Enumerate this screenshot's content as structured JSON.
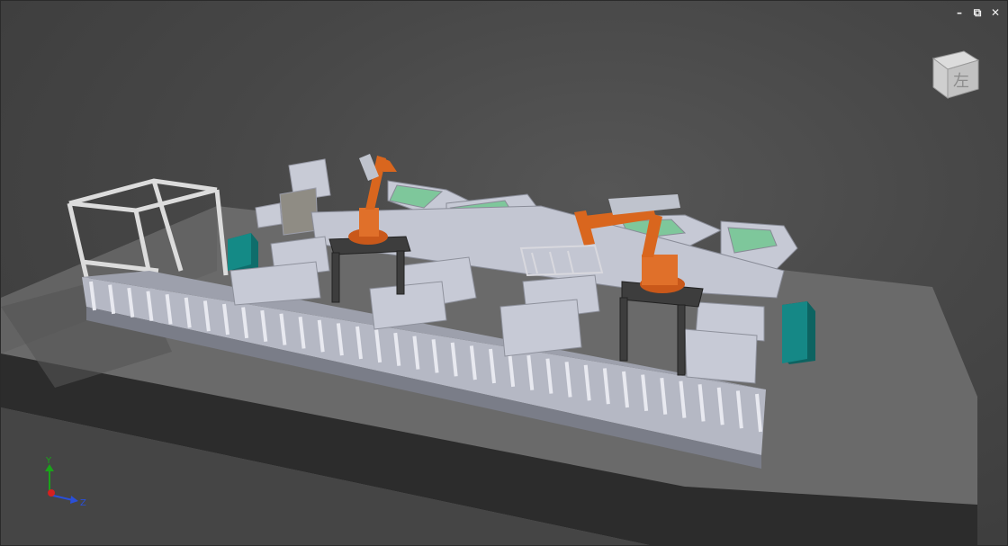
{
  "window": {
    "controls": {
      "minimize": "–",
      "restore": "⧉",
      "close": "✕"
    }
  },
  "view_cube": {
    "face_label": "左"
  },
  "axis_triad": {
    "y_label": "Y",
    "z_label": "Z",
    "colors": {
      "y": "#1aa31a",
      "z": "#2a4fd8",
      "x": "#d62020"
    }
  },
  "scene": {
    "description_icons": [
      "robot-arm-icon",
      "conveyor-icon",
      "gantry-frame-icon",
      "control-cabinet-icon"
    ],
    "colors": {
      "background": "#474747",
      "floor": "#6c6c6c",
      "platform_side": "#2f2f2f",
      "machine": "#c9ccd8",
      "robot": "#d9661e",
      "work_table": "#7dc79a",
      "cabinet": "#116a6a"
    }
  }
}
